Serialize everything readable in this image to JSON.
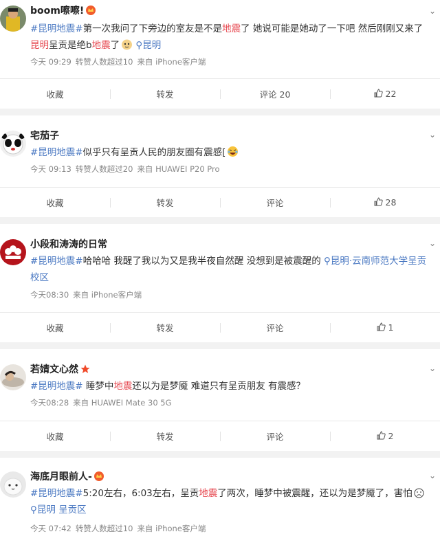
{
  "posts": [
    {
      "author": "boom嚓嚓!",
      "badge": "crown-badge",
      "text": [
        {
          "t": "#昆明地震#",
          "c": "tag"
        },
        {
          "t": "第一次我问了下旁边的室友是不是",
          "c": ""
        },
        {
          "t": "地震",
          "c": "kw"
        },
        {
          "t": "了 她说可能是她动了一下吧 然后刚刚又来了 ",
          "c": ""
        },
        {
          "t": "昆明",
          "c": "kw"
        },
        {
          "t": "呈贡是绝b",
          "c": ""
        },
        {
          "t": "地震",
          "c": "kw"
        },
        {
          "t": "了",
          "c": ""
        }
      ],
      "emoji": "doge-emoji",
      "location": "昆明",
      "time": "今天 09:29",
      "reposts_note": "转赞人数超过10",
      "source": "来自 iPhone客户端",
      "actions": {
        "fav": "收藏",
        "repost": "转发",
        "comment": "评论 20",
        "like": "22"
      }
    },
    {
      "author": "宅茄子",
      "badge": "",
      "text": [
        {
          "t": "#昆明地震#",
          "c": "tag"
        },
        {
          "t": "似乎只有呈贡人民的朋友圈有震感[",
          "c": ""
        }
      ],
      "emoji": "laugh-emoji",
      "location": "",
      "time": "今天 09:13",
      "reposts_note": "转赞人数超过20",
      "source": "来自 HUAWEI P20 Pro",
      "actions": {
        "fav": "收藏",
        "repost": "转发",
        "comment": "评论",
        "like": "28"
      }
    },
    {
      "author": "小段和涛涛的日常",
      "badge": "",
      "text": [
        {
          "t": "#昆明地震#",
          "c": "tag"
        },
        {
          "t": "哈哈哈 我醒了我以为又是我半夜自然醒 没想到是被震醒的 ",
          "c": ""
        }
      ],
      "emoji": "",
      "location": "昆明·云南师范大学呈贡校区",
      "time": "今天08:30",
      "reposts_note": "",
      "source": "来自 iPhone客户端",
      "actions": {
        "fav": "收藏",
        "repost": "转发",
        "comment": "评论",
        "like": "1"
      }
    },
    {
      "author": "若婧文心然",
      "badge": "star-badge",
      "text": [
        {
          "t": "#昆明地震#",
          "c": "tag"
        },
        {
          "t": " 睡梦中",
          "c": ""
        },
        {
          "t": "地震",
          "c": "kw"
        },
        {
          "t": "还以为是梦魇 难道只有呈贡朋友 有震感？",
          "c": ""
        }
      ],
      "emoji": "",
      "location": "",
      "time": "今天08:28",
      "reposts_note": "",
      "source": "来自 HUAWEI Mate 30 5G",
      "actions": {
        "fav": "收藏",
        "repost": "转发",
        "comment": "评论",
        "like": "2"
      }
    },
    {
      "author": "海底月眼前人-",
      "badge": "crown-badge",
      "text": [
        {
          "t": "#昆明地震#",
          "c": "tag"
        },
        {
          "t": "5:20左右，6:03左右，呈贡",
          "c": ""
        },
        {
          "t": "地震",
          "c": "kw"
        },
        {
          "t": "了两次，睡梦中被震醒，还以为是梦魇了，害怕",
          "c": ""
        }
      ],
      "emoji": "sad-emoji",
      "location": "昆明 呈贡区",
      "time": "今天 07:42",
      "reposts_note": "转赞人数超过10",
      "source": "来自 iPhone客户端",
      "actions": null
    }
  ]
}
